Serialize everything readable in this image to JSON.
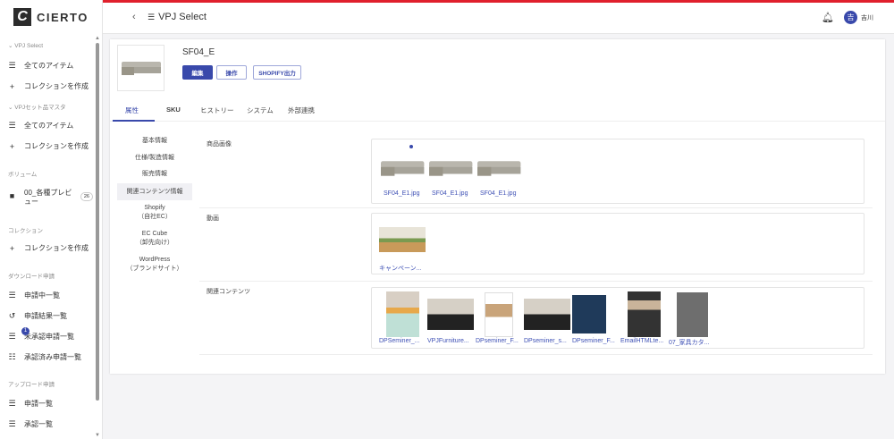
{
  "brand": {
    "name": "CIERTO",
    "mark": "C"
  },
  "sidebar": {
    "sections": [
      {
        "label": "VPJ Select",
        "items": [
          "全てのアイテム",
          "コレクションを作成"
        ]
      },
      {
        "label": "VPJセット品マスタ",
        "items": [
          "全てのアイテム",
          "コレクションを作成"
        ]
      },
      {
        "label": "ボリューム",
        "items": [
          "00_各種プレビュー"
        ],
        "count": "26"
      },
      {
        "label": "コレクション",
        "items": [
          "コレクションを作成"
        ]
      },
      {
        "label": "ダウンロード申請",
        "items": [
          "申請中一覧",
          "申請結果一覧",
          "未承認申請一覧",
          "承認済み申請一覧"
        ],
        "badge": "1"
      },
      {
        "label": "アップロード申請",
        "items": [
          "申請一覧",
          "承認一覧"
        ]
      }
    ]
  },
  "header": {
    "title": "VPJ Select",
    "user_initial": "吉",
    "user_name": "吉川"
  },
  "product": {
    "name": "SF04_E",
    "buttons": [
      "編集",
      "操作",
      "SHOPIFY出力"
    ]
  },
  "tabs": [
    "属性",
    "SKU",
    "ヒストリー",
    "システム",
    "外部連携"
  ],
  "subnav": [
    "基本情報",
    "仕様/製造情報",
    "販売情報",
    "関連コンテンツ情報",
    "Shopify\n（自社EC）",
    "EC Cube\n（卸先向け）",
    "WordPress\n（ブランドサイト）"
  ],
  "fields": {
    "images": {
      "label": "商品画像",
      "files": [
        "SF04_E1.jpg",
        "SF04_E1.jpg",
        "SF04_E1.jpg"
      ]
    },
    "video": {
      "label": "動画",
      "files": [
        "キャンペーン..."
      ]
    },
    "related": {
      "label": "関連コンテンツ",
      "files": [
        "DPSeminer_...",
        "VPJFurniture...",
        "DPseminer_F...",
        "DPseminer_s...",
        "DPseminer_F...",
        "EmailHTMLte...",
        "07_家具カタ..."
      ]
    }
  },
  "colors": {
    "accent": "#3949ab",
    "topbar": "#e0202c"
  }
}
